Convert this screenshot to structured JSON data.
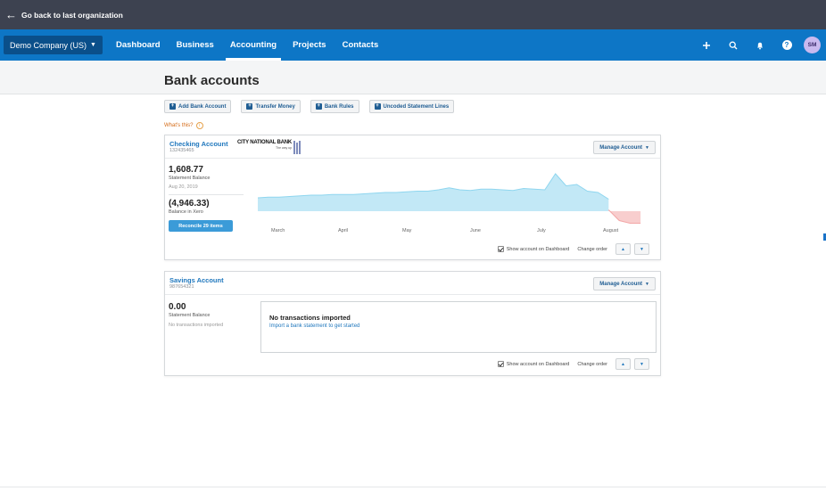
{
  "topbar": {
    "back_label": "Go back to last organization"
  },
  "nav": {
    "org": "Demo Company (US)",
    "items": [
      "Dashboard",
      "Business",
      "Accounting",
      "Projects",
      "Contacts"
    ],
    "avatar_initials": "SM",
    "accent_color": "#0d76c6"
  },
  "page": {
    "title": "Bank accounts",
    "actions": [
      "Add Bank Account",
      "Transfer Money",
      "Bank Rules",
      "Uncoded Statement Lines"
    ],
    "whats_this": "What's this?"
  },
  "checking": {
    "name": "Checking Account",
    "number": "132435465",
    "bank_name": "CITY NATIONAL BANK",
    "bank_tagline": "The way up",
    "manage_label": "Manage Account",
    "statement_balance": "1,608.77",
    "statement_label": "Statement Balance",
    "statement_date": "Aug 20, 2019",
    "xero_balance": "(4,946.33)",
    "xero_label": "Balance in Xero",
    "reconcile_label": "Reconcile 29 items",
    "show_dashboard_label": "Show account on Dashboard",
    "change_order_label": "Change order"
  },
  "savings": {
    "name": "Savings Account",
    "number": "987654321",
    "manage_label": "Manage Account",
    "statement_balance": "0.00",
    "statement_label": "Statement Balance",
    "no_tx_label": "No transactions imported",
    "empty_title": "No transactions imported",
    "empty_link": "Import a bank statement to get started",
    "show_dashboard_label": "Show account on Dashboard",
    "change_order_label": "Change order"
  },
  "chart_data": {
    "type": "area",
    "x_labels": [
      "March",
      "April",
      "May",
      "June",
      "July",
      "August"
    ],
    "series": [
      {
        "color": "#8fd6ef",
        "values": [
          2,
          2.1,
          2.1,
          2.2,
          2.3,
          2.4,
          2.4,
          2.5,
          2.5,
          2.5,
          2.6,
          2.7,
          2.8,
          2.8,
          2.9,
          3.0,
          3.0,
          3.2,
          3.5,
          3.2,
          3.1,
          3.3,
          3.3,
          3.2,
          3.1,
          3.4,
          3.3,
          3.2,
          5.6,
          3.8,
          4.0,
          3.0,
          2.8,
          1.8
        ]
      },
      {
        "color": "#f3a6a6",
        "values": [
          0.2,
          -1.4,
          -1.8,
          -1.8
        ]
      }
    ]
  }
}
